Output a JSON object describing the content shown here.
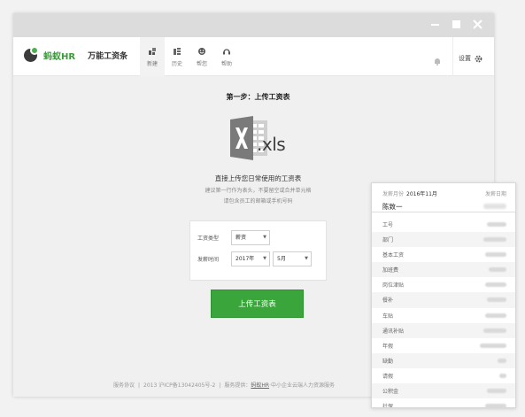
{
  "app": {
    "logo_text": "蚂蚁HR",
    "product_name": "万能工资条"
  },
  "window_controls": [
    "minimize",
    "maximize",
    "close"
  ],
  "nav_tabs": [
    {
      "label": "新建",
      "icon": "new-icon",
      "active": true
    },
    {
      "label": "历史",
      "icon": "history-icon",
      "active": false
    },
    {
      "label": "帮您",
      "icon": "smile-icon",
      "active": false
    },
    {
      "label": "帮助",
      "icon": "headset-icon",
      "active": false
    }
  ],
  "settings_label": "设置",
  "main": {
    "step_title": "第一步：上传工资表",
    "file_ext": ".xls",
    "upload_desc": "直接上传您日常使用的工资表",
    "hint_line1": "建议第一行作为表头，不要留空或合并单元格",
    "hint_line2": "请包含员工的邮箱或手机号码"
  },
  "form": {
    "type_label": "工资类型",
    "type_value": "薪资",
    "time_label": "发薪时间",
    "year_value": "2017年",
    "month_value": "5月"
  },
  "upload_button": "上传工资表",
  "footer": {
    "service_terms": "服务协议",
    "copyright": "2013 沪ICP备13042405号-2",
    "provider_prefix": "服务提供：",
    "provider_link": "蚂蚁HR",
    "provider_suffix": "·中小企业云端人力资源服务"
  },
  "payslip": {
    "month_label": "发薪月份",
    "month_value": "2016年11月",
    "date_label": "发薪日期",
    "employee_name": "陈致一",
    "rows": [
      "工号",
      "部门",
      "基本工资",
      "加班费",
      "岗位津贴",
      "餐补",
      "车贴",
      "通讯补贴",
      "年假",
      "缺勤",
      "请假",
      "公积金",
      "社保"
    ]
  },
  "colors": {
    "accent_green": "#3aa53a",
    "titlebar_gray": "#dcdcdc"
  }
}
